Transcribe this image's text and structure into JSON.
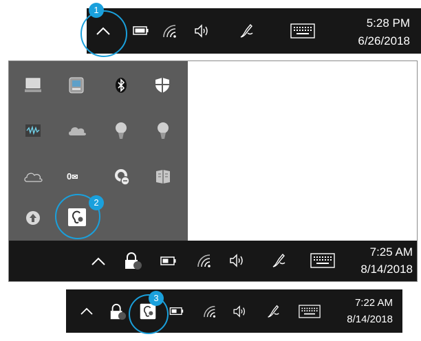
{
  "step1": {
    "badge": "1",
    "clock": {
      "time": "5:28 PM",
      "date": "6/26/2018"
    },
    "icons": [
      "chevron-up-icon",
      "battery-icon",
      "wifi-icon",
      "volume-icon",
      "pen-icon",
      "keyboard-icon"
    ]
  },
  "step2": {
    "badge": "2",
    "clock": {
      "time": "7:25 AM",
      "date": "8/14/2018"
    },
    "overflow_icons": [
      "laptop-icon",
      "network-adapter-icon",
      "bluetooth-icon",
      "windows-defender-icon",
      "waves-audio-icon",
      "onedrive-icon",
      "lightbulb-icon",
      "lightbulb-icon-2",
      "cloud-outline-icon",
      "outlook-icon",
      "skype-icon",
      "book-icon",
      "upload-icon",
      "hearing-icon"
    ],
    "outlook_count": "0"
  },
  "step3": {
    "badge": "3",
    "clock": {
      "time": "7:22 AM",
      "date": "8/14/2018"
    }
  },
  "colors": {
    "taskbar": "#171717",
    "overflow": "#5b5b5b",
    "accent": "#1aa0dc"
  }
}
